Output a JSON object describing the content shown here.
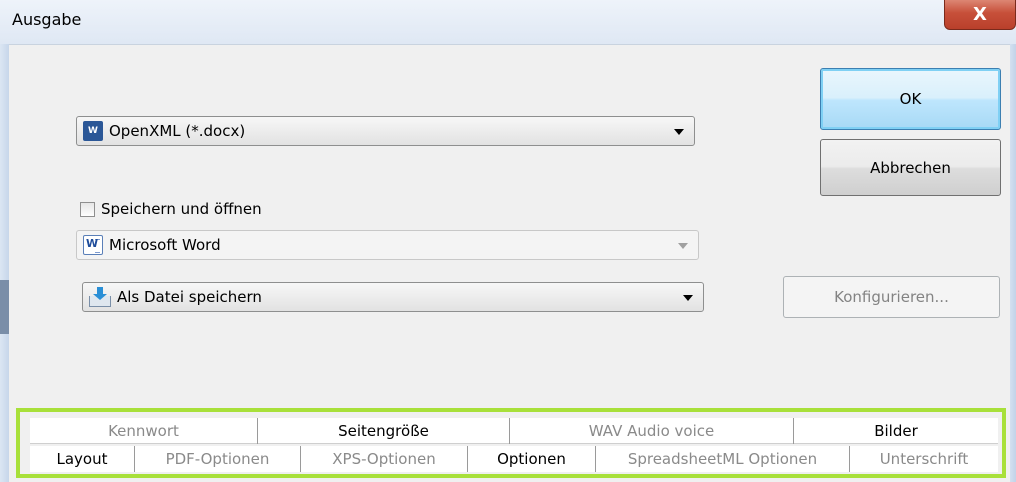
{
  "window": {
    "title": "Ausgabe",
    "close_symbol": "X"
  },
  "format_select": {
    "value": "OpenXML (*.docx)",
    "icon": "docx-icon"
  },
  "save_and_open": {
    "label": "Speichern und öffnen",
    "checked": false
  },
  "app_select": {
    "value": "Microsoft Word",
    "icon": "word-icon",
    "disabled": true
  },
  "action_select": {
    "value": "Als Datei speichern",
    "icon": "save-download-icon"
  },
  "buttons": {
    "ok": "OK",
    "cancel": "Abbrechen",
    "configure": "Konfigurieren..."
  },
  "tabs_row1": [
    {
      "label": "Kennwort",
      "state": "inactive"
    },
    {
      "label": "Seitengröße",
      "state": "enabled"
    },
    {
      "label": "WAV Audio voice",
      "state": "inactive"
    },
    {
      "label": "Bilder",
      "state": "enabled"
    }
  ],
  "tabs_row2": [
    {
      "label": "Layout",
      "state": "enabled"
    },
    {
      "label": "PDF-Optionen",
      "state": "inactive"
    },
    {
      "label": "XPS-Optionen",
      "state": "inactive"
    },
    {
      "label": "Optionen",
      "state": "selected"
    },
    {
      "label": "SpreadsheetML Optionen",
      "state": "inactive"
    },
    {
      "label": "Unterschrift",
      "state": "inactive"
    }
  ],
  "colors": {
    "highlight_outline": "#a8e03a",
    "close_button": "#c7503a",
    "default_button_border": "#3c7fb1"
  }
}
